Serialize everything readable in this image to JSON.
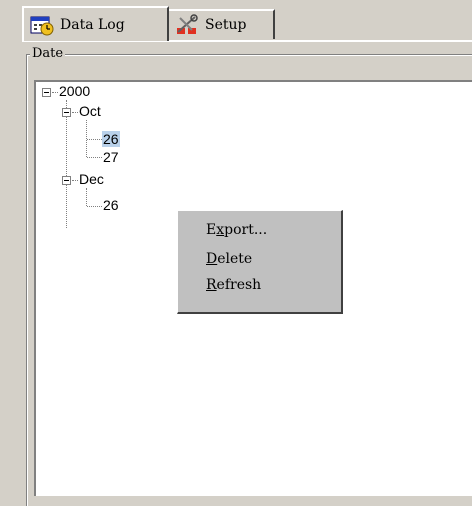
{
  "tabs": [
    {
      "label": "Data Log",
      "icon": "calendar-clock-icon",
      "active": true
    },
    {
      "label": "Setup",
      "icon": "wrench-tools-icon",
      "active": false
    }
  ],
  "group_label": "Date",
  "tree": {
    "year": "2000",
    "months": [
      {
        "label": "Oct",
        "days": [
          "26",
          "27"
        ]
      },
      {
        "label": "Dec",
        "days": [
          "26"
        ]
      }
    ]
  },
  "context_menu": {
    "items": [
      {
        "label": "Export...",
        "mnemonic": "x"
      },
      {
        "label": "Delete",
        "mnemonic": "D"
      },
      {
        "label": "Refresh",
        "mnemonic": "R"
      }
    ]
  },
  "colors": {
    "chrome": "#d4d0c8",
    "selection": "#b9d1ea",
    "menu": "#c0c0c0"
  }
}
